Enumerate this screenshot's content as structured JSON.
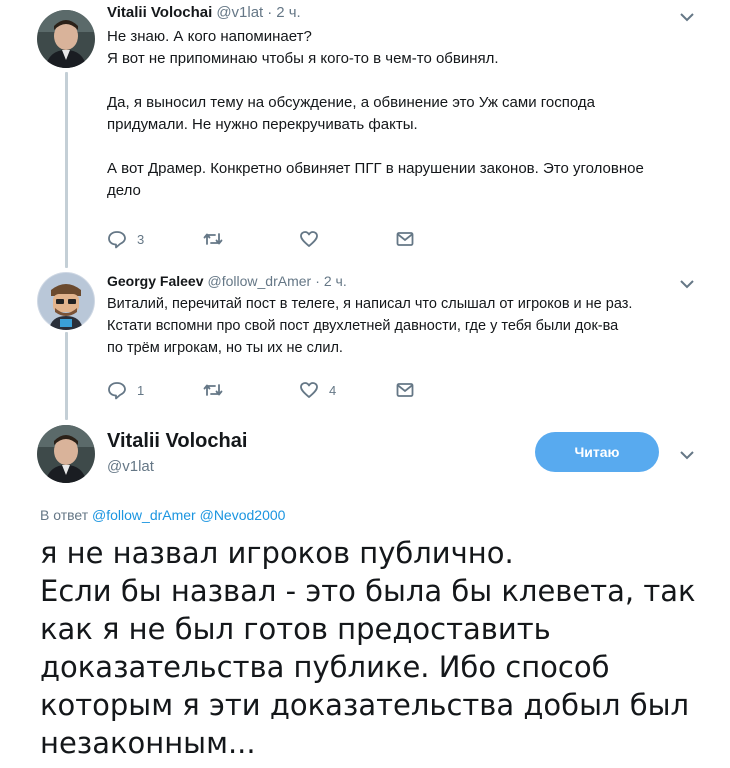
{
  "tweets": [
    {
      "author_name": "Vitalii Volochai",
      "author_handle": "@v1lat",
      "separator": "·",
      "time": "2 ч.",
      "lines": [
        "Не знаю. А кого напоминает?",
        "Я вот не припоминаю чтобы я кого-то в чем-то обвинял.",
        "",
        "Да, я выносил тему на обсуждение, а обвинение это Уж сами господа",
        "придумали. Не нужно перекручивать факты.",
        "",
        "А вот Драмер. Конкретно обвиняет ПГГ в нарушении законов. Это уголовное",
        "дело"
      ],
      "replies": "3",
      "retweets": "",
      "likes": ""
    },
    {
      "author_name": "Georgy Faleev",
      "author_handle": "@follow_drAmer",
      "separator": "·",
      "time": "2 ч.",
      "lines": [
        "Виталий, перечитай пост в телеге, я написал что слышал от игроков и не раз.",
        "Кстати вспомни про свой пост двухлетней давности, где у тебя были док-ва",
        "по трём игрокам, но ты их не слил."
      ],
      "replies": "1",
      "retweets": "",
      "likes": "4"
    }
  ],
  "main_tweet": {
    "author_name": "Vitalii Volochai",
    "author_handle": "@v1lat",
    "follow_button": "Читаю",
    "reply_prefix": "В ответ",
    "reply_mention_1": "@follow_drAmer",
    "reply_mention_2": "@Nevod2000",
    "lines": [
      "я не назвал игроков публично.",
      "Если бы назвал - это была бы клевета, так",
      "как я не был готов предоставить",
      "доказательства публике. Ибо способ",
      "которым я эти доказательства добыл был",
      "незаконным..."
    ]
  },
  "icons": {
    "reply": "reply-icon",
    "retweet": "retweet-icon",
    "like": "heart-icon",
    "dm": "envelope-icon",
    "menu": "chevron-down-icon"
  },
  "colors": {
    "accent": "#1b95e0",
    "follow_button": "#58aaef",
    "muted": "#657786",
    "thread_line": "#c4cfd6"
  }
}
